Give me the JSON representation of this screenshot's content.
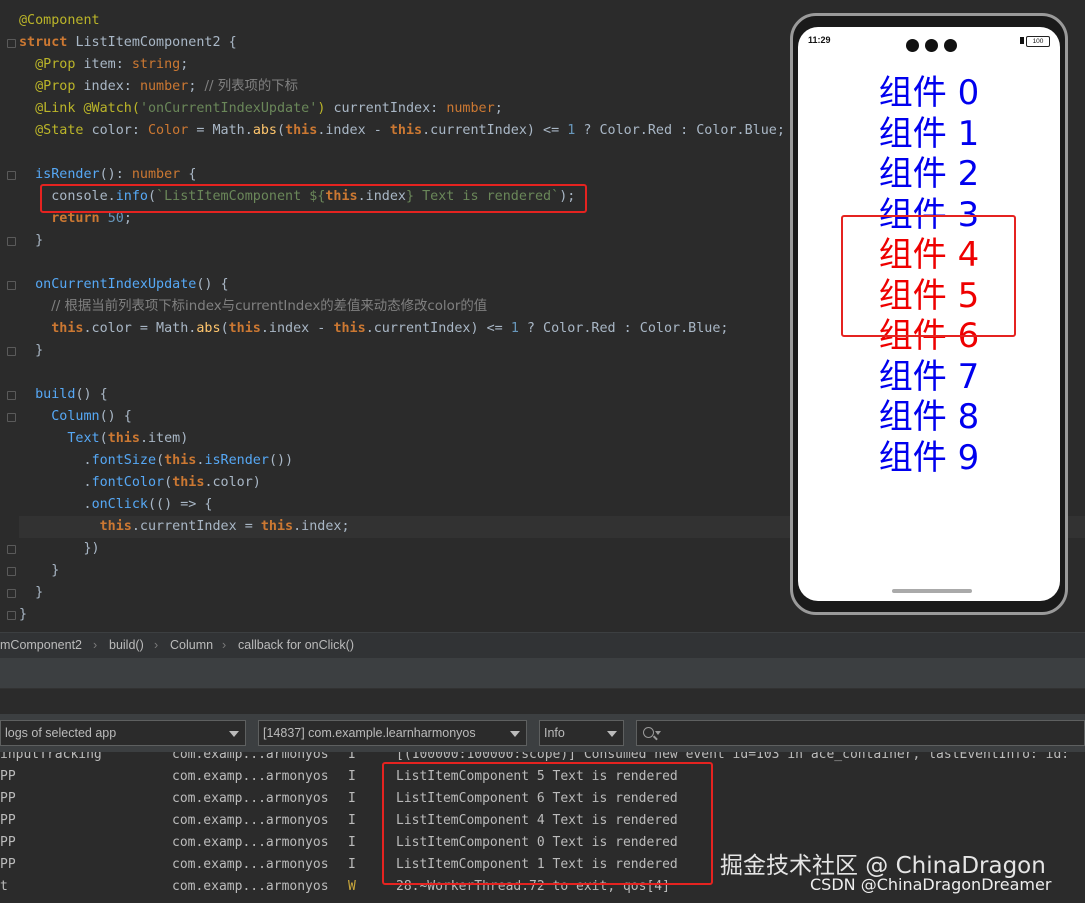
{
  "editor": {
    "lines": [
      [
        [
          "t-ann",
          "@Component"
        ]
      ],
      [
        [
          "t-kw",
          "struct "
        ],
        [
          "t-cls",
          "ListItemComponent2 "
        ],
        [
          "t-plain",
          "{"
        ]
      ],
      [
        [
          "t-plain",
          "  "
        ],
        [
          "t-ann",
          "@Prop "
        ],
        [
          "t-plain",
          "item: "
        ],
        [
          "t-ty",
          "string"
        ],
        [
          "t-plain",
          ";"
        ]
      ],
      [
        [
          "t-plain",
          "  "
        ],
        [
          "t-ann",
          "@Prop "
        ],
        [
          "t-plain",
          "index: "
        ],
        [
          "t-ty",
          "number"
        ],
        [
          "t-plain",
          "; "
        ],
        [
          "t-cmt",
          "// 列表项的下标"
        ]
      ],
      [
        [
          "t-plain",
          "  "
        ],
        [
          "t-ann",
          "@Link @Watch("
        ],
        [
          "t-str",
          "'onCurrentIndexUpdate'"
        ],
        [
          "t-ann",
          ") "
        ],
        [
          "t-plain",
          "currentIndex: "
        ],
        [
          "t-ty",
          "number"
        ],
        [
          "t-plain",
          ";"
        ]
      ],
      [
        [
          "t-plain",
          "  "
        ],
        [
          "t-ann",
          "@State "
        ],
        [
          "t-plain",
          "color: "
        ],
        [
          "t-ty",
          "Color "
        ],
        [
          "t-plain",
          "= Math."
        ],
        [
          "t-fn",
          "abs"
        ],
        [
          "t-plain",
          "("
        ],
        [
          "t-this",
          "this"
        ],
        [
          "t-plain",
          ".index - "
        ],
        [
          "t-this",
          "this"
        ],
        [
          "t-plain",
          ".currentIndex) <= "
        ],
        [
          "t-num",
          "1"
        ],
        [
          "t-plain",
          " ? Color.Red : Color.Blue;"
        ]
      ],
      [],
      [
        [
          "t-plain",
          "  "
        ],
        [
          "t-fn2",
          "isRender"
        ],
        [
          "t-plain",
          "(): "
        ],
        [
          "t-ty",
          "number "
        ],
        [
          "t-plain",
          "{"
        ]
      ],
      [
        [
          "t-plain",
          "    console."
        ],
        [
          "t-fn2",
          "info"
        ],
        [
          "t-plain",
          "("
        ],
        [
          "t-tpl",
          "`ListItemComponent ${"
        ],
        [
          "t-this",
          "this"
        ],
        [
          "t-plain",
          ".index"
        ],
        [
          "t-tpl",
          "} Text is rendered`"
        ],
        [
          "t-plain",
          ");"
        ]
      ],
      [
        [
          "t-plain",
          "    "
        ],
        [
          "t-kw",
          "return "
        ],
        [
          "t-num",
          "50"
        ],
        [
          "t-plain",
          ";"
        ]
      ],
      [
        [
          "t-plain",
          "  }"
        ]
      ],
      [],
      [
        [
          "t-plain",
          "  "
        ],
        [
          "t-fn2",
          "onCurrentIndexUpdate"
        ],
        [
          "t-plain",
          "() {"
        ]
      ],
      [
        [
          "t-plain",
          "    "
        ],
        [
          "t-cmt",
          "// 根据当前列表项下标index与currentIndex的差值来动态修改color的值"
        ]
      ],
      [
        [
          "t-plain",
          "    "
        ],
        [
          "t-this",
          "this"
        ],
        [
          "t-plain",
          ".color = Math."
        ],
        [
          "t-fn",
          "abs"
        ],
        [
          "t-plain",
          "("
        ],
        [
          "t-this",
          "this"
        ],
        [
          "t-plain",
          ".index - "
        ],
        [
          "t-this",
          "this"
        ],
        [
          "t-plain",
          ".currentIndex) <= "
        ],
        [
          "t-num",
          "1"
        ],
        [
          "t-plain",
          " ? Color.Red : Color.Blue;"
        ]
      ],
      [
        [
          "t-plain",
          "  }"
        ]
      ],
      [],
      [
        [
          "t-plain",
          "  "
        ],
        [
          "t-fn2",
          "build"
        ],
        [
          "t-plain",
          "() {"
        ]
      ],
      [
        [
          "t-plain",
          "    "
        ],
        [
          "t-fn2",
          "Column"
        ],
        [
          "t-plain",
          "() {"
        ]
      ],
      [
        [
          "t-plain",
          "      "
        ],
        [
          "t-fn2",
          "Text"
        ],
        [
          "t-plain",
          "("
        ],
        [
          "t-this",
          "this"
        ],
        [
          "t-plain",
          ".item)"
        ]
      ],
      [
        [
          "t-plain",
          "        ."
        ],
        [
          "t-fn2",
          "fontSize"
        ],
        [
          "t-plain",
          "("
        ],
        [
          "t-this",
          "this"
        ],
        [
          "t-plain",
          "."
        ],
        [
          "t-fn2",
          "isRender"
        ],
        [
          "t-plain",
          "())"
        ]
      ],
      [
        [
          "t-plain",
          "        ."
        ],
        [
          "t-fn2",
          "fontColor"
        ],
        [
          "t-plain",
          "("
        ],
        [
          "t-this",
          "this"
        ],
        [
          "t-plain",
          ".color)"
        ]
      ],
      [
        [
          "t-plain",
          "        ."
        ],
        [
          "t-fn2",
          "onClick"
        ],
        [
          "t-plain",
          "(() => {"
        ]
      ],
      [
        [
          "t-plain",
          "          "
        ],
        [
          "t-this",
          "this"
        ],
        [
          "t-plain",
          ".currentIndex = "
        ],
        [
          "t-this",
          "this"
        ],
        [
          "t-plain",
          ".index;"
        ]
      ],
      [
        [
          "t-plain",
          "        })"
        ]
      ],
      [
        [
          "t-plain",
          "    }"
        ]
      ],
      [
        [
          "t-plain",
          "  }"
        ]
      ],
      [
        [
          "t-plain",
          "}"
        ]
      ]
    ]
  },
  "phone": {
    "time": "11:29",
    "battery": "100",
    "items": [
      {
        "label": "组件 0",
        "color": "#0000ee"
      },
      {
        "label": "组件 1",
        "color": "#0000ee"
      },
      {
        "label": "组件 2",
        "color": "#0000ee"
      },
      {
        "label": "组件 3",
        "color": "#0000ee"
      },
      {
        "label": "组件 4",
        "color": "#ee0000"
      },
      {
        "label": "组件 5",
        "color": "#ee0000"
      },
      {
        "label": "组件 6",
        "color": "#ee0000"
      },
      {
        "label": "组件 7",
        "color": "#0000ee"
      },
      {
        "label": "组件 8",
        "color": "#0000ee"
      },
      {
        "label": "组件 9",
        "color": "#0000ee"
      }
    ]
  },
  "breadcrumb": {
    "items": [
      "mComponent2",
      "build()",
      "Column",
      "callback for onClick()"
    ]
  },
  "filters": {
    "app_filter": "logs of selected app",
    "process": "[14837] com.example.learnharmonyos",
    "level": "Info"
  },
  "logs": [
    {
      "tag": "inputTracking",
      "pkg": "com.examp...armonyos",
      "level": "I",
      "msg": "[(100000:100000:scope)] Consumed new event id=103 in ace_container, lastEventInfo: id:"
    },
    {
      "tag": "PP",
      "pkg": "com.examp...armonyos",
      "level": "I",
      "msg": "ListItemComponent 5 Text is rendered"
    },
    {
      "tag": "PP",
      "pkg": "com.examp...armonyos",
      "level": "I",
      "msg": "ListItemComponent 6 Text is rendered"
    },
    {
      "tag": "PP",
      "pkg": "com.examp...armonyos",
      "level": "I",
      "msg": "ListItemComponent 4 Text is rendered"
    },
    {
      "tag": "PP",
      "pkg": "com.examp...armonyos",
      "level": "I",
      "msg": "ListItemComponent 0 Text is rendered"
    },
    {
      "tag": "PP",
      "pkg": "com.examp...armonyos",
      "level": "I",
      "msg": "ListItemComponent 1 Text is rendered"
    },
    {
      "tag": "t",
      "pkg": "com.examp...armonyos",
      "level": "W",
      "msg": "28:~WorkerThread:72 to exit, qos[4]"
    }
  ],
  "watermark": {
    "line1": "掘金技术社区 @ ChinaDragon",
    "line2": "CSDN @ChinaDragonDreamer"
  }
}
